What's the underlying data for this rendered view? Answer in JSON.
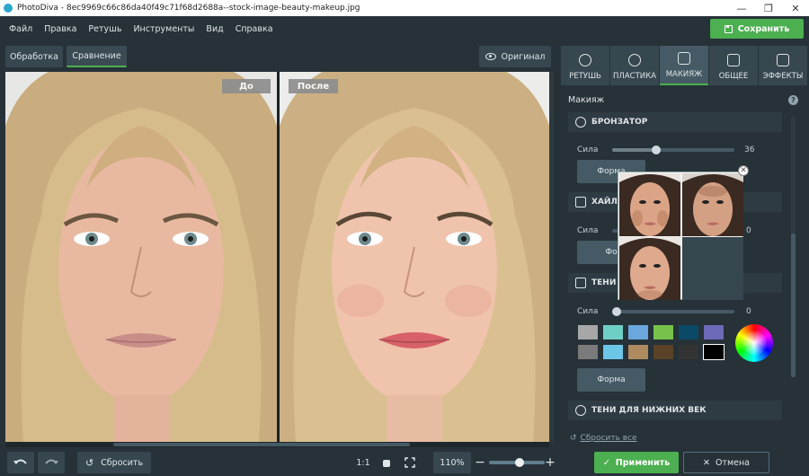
{
  "window": {
    "title": "PhotoDiva - 8ec9969c66c86da40f49c71f68d2688a--stock-image-beauty-makeup.jpg",
    "controls": {
      "minimize": "—",
      "maximize": "❐",
      "close": "✕"
    }
  },
  "menu": [
    "Файл",
    "Правка",
    "Ретушь",
    "Инструменты",
    "Вид",
    "Справка"
  ],
  "save_label": "Сохранить",
  "view_tabs": [
    {
      "label": "Обработка",
      "active": false
    },
    {
      "label": "Сравнение",
      "active": true
    }
  ],
  "original_label": "Оригинал",
  "compare": {
    "before": "До",
    "after": "После"
  },
  "panel_tabs": [
    {
      "label": "РЕТУШЬ",
      "icon": "retouch-icon",
      "active": false
    },
    {
      "label": "ПЛАСТИКА",
      "icon": "plastic-icon",
      "active": false
    },
    {
      "label": "МАКИЯЖ",
      "icon": "makeup-icon",
      "active": true
    },
    {
      "label": "ОБЩЕЕ",
      "icon": "sliders-icon",
      "active": false
    },
    {
      "label": "ЭФФЕКТЫ",
      "icon": "effects-icon",
      "active": false
    }
  ],
  "panel_title": "Макияж",
  "help": "?",
  "bronzer": {
    "title": "БРОНЗАТОР",
    "strength_label": "Сила",
    "strength_value": "36",
    "strength_fraction": 0.36,
    "form_label": "Форма"
  },
  "highlighter": {
    "title": "ХАЙЛ",
    "strength_label": "Сила",
    "strength_value": "0",
    "form_label": "Фо"
  },
  "shadows": {
    "title": "ТЕНИ",
    "strength_label": "Сила",
    "strength_value": "0",
    "form_label": "Форма",
    "swatches": [
      "#a7a7a7",
      "#6fcfc6",
      "#6aa7dd",
      "#76c24c",
      "#0a4a66",
      "#6a6ab8",
      "#7a7a7a",
      "#6cc6e8",
      "#b08a5f",
      "#5a4327",
      "#333333",
      "#000000"
    ]
  },
  "lower_shadows": {
    "title": "ТЕНИ ДЛЯ НИЖНИХ ВЕК"
  },
  "reset_all": "Сбросить все",
  "bottom": {
    "reset": "Сбросить",
    "ratio": "1:1",
    "zoom": "110%",
    "zoom_fraction": 0.55
  },
  "apply": "Применить",
  "cancel": "Отмена"
}
